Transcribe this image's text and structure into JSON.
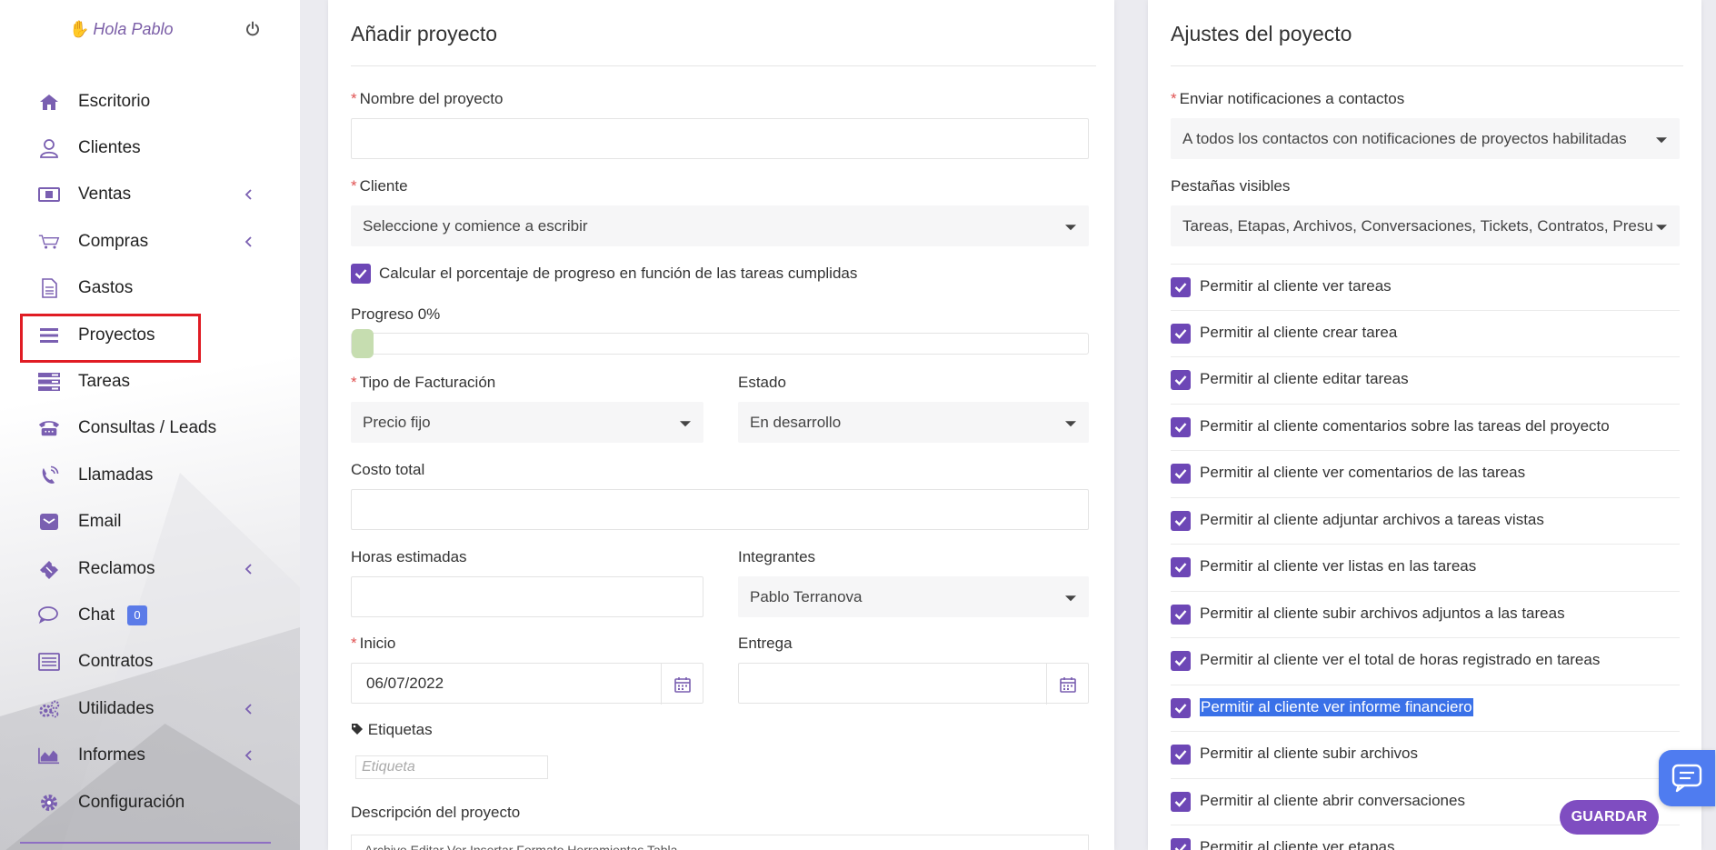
{
  "colors": {
    "accent": "#6d47b6",
    "primary_button": "#7f4dc1",
    "chat_float": "#4f7cf0",
    "badge": "#5b7be8",
    "required": "#e05252",
    "active_outline": "#e01c24",
    "selection": "#3a71e8",
    "progress_fill": "#c6ddb0"
  },
  "user": {
    "greeting": "Hola Pablo",
    "wave_icon": "waving-hand-icon",
    "power_icon": "power-icon"
  },
  "sidebar": {
    "items": [
      {
        "label": "Escritorio",
        "icon": "home-icon"
      },
      {
        "label": "Clientes",
        "icon": "user-icon"
      },
      {
        "label": "Ventas",
        "icon": "money-icon",
        "expandable": true
      },
      {
        "label": "Compras",
        "icon": "cart-icon",
        "expandable": true
      },
      {
        "label": "Gastos",
        "icon": "document-icon"
      },
      {
        "label": "Proyectos",
        "icon": "bars-icon",
        "active": true
      },
      {
        "label": "Tareas",
        "icon": "tasks-icon"
      },
      {
        "label": "Consultas / Leads",
        "icon": "phone-desk-icon"
      },
      {
        "label": "Llamadas",
        "icon": "phone-volume-icon"
      },
      {
        "label": "Email",
        "icon": "envelope-icon"
      },
      {
        "label": "Reclamos",
        "icon": "ticket-icon",
        "expandable": true
      },
      {
        "label": "Chat",
        "icon": "chat-icon",
        "badge": "0"
      },
      {
        "label": "Contratos",
        "icon": "contract-icon"
      },
      {
        "label": "Utilidades",
        "icon": "cogs-icon",
        "expandable": true
      },
      {
        "label": "Informes",
        "icon": "area-chart-icon",
        "expandable": true
      },
      {
        "label": "Configuración",
        "icon": "gear-icon"
      }
    ]
  },
  "add_project": {
    "title": "Añadir proyecto",
    "name_label": "Nombre del proyecto",
    "name_value": "",
    "client_label": "Cliente",
    "client_placeholder": "Seleccione y comience a escribir",
    "calc_progress_label": "Calcular el porcentaje de progreso en función de las tareas cumplidas",
    "calc_progress_checked": true,
    "progress_label": "Progreso 0%",
    "progress_value": 0,
    "billing_label": "Tipo de Facturación",
    "billing_value": "Precio fijo",
    "status_label": "Estado",
    "status_value": "En desarrollo",
    "total_cost_label": "Costo total",
    "total_cost_value": "",
    "est_hours_label": "Horas estimadas",
    "est_hours_value": "",
    "members_label": "Integrantes",
    "members_value": "Pablo Terranova",
    "start_label": "Inicio",
    "start_value": "06/07/2022",
    "due_label": "Entrega",
    "due_value": "",
    "tags_label": "Etiquetas",
    "tags_placeholder": "Etiqueta",
    "description_label": "Descripción del proyecto",
    "editor_toolbar": "Archivo    Editar    Ver    Insertar    Formato    Herramientas    Tabla"
  },
  "project_settings": {
    "title": "Ajustes del poyecto",
    "notify_label": "Enviar notificaciones a contactos",
    "notify_value": "A todos los contactos con notificaciones de proyectos habilitadas",
    "tabs_label": "Pestañas visibles",
    "tabs_value": "Tareas, Etapas, Archivos, Conversaciones, Tickets, Contratos, Presupuestos",
    "permissions": [
      {
        "label": "Permitir al cliente ver tareas",
        "checked": true
      },
      {
        "label": "Permitir al cliente crear tarea",
        "checked": true
      },
      {
        "label": "Permitir al cliente editar tareas",
        "checked": true
      },
      {
        "label": "Permitir al cliente comentarios sobre las tareas del proyecto",
        "checked": true
      },
      {
        "label": "Permitir al cliente ver comentarios de las tareas",
        "checked": true
      },
      {
        "label": "Permitir al cliente adjuntar archivos a tareas vistas",
        "checked": true
      },
      {
        "label": "Permitir al cliente ver listas en las tareas",
        "checked": true
      },
      {
        "label": "Permitir al cliente subir archivos adjuntos a las tareas",
        "checked": true
      },
      {
        "label": "Permitir al cliente ver el total de horas registrado en tareas",
        "checked": true
      },
      {
        "label": "Permitir al cliente ver informe financiero",
        "checked": true,
        "selected_text": true
      },
      {
        "label": "Permitir al cliente subir archivos",
        "checked": true
      },
      {
        "label": "Permitir al cliente abrir conversaciones",
        "checked": true
      },
      {
        "label": "Permitir al cliente ver etapas",
        "checked": true
      }
    ]
  },
  "actions": {
    "save_label": "GUARDAR",
    "chat_icon": "chat-bubble-icon"
  }
}
